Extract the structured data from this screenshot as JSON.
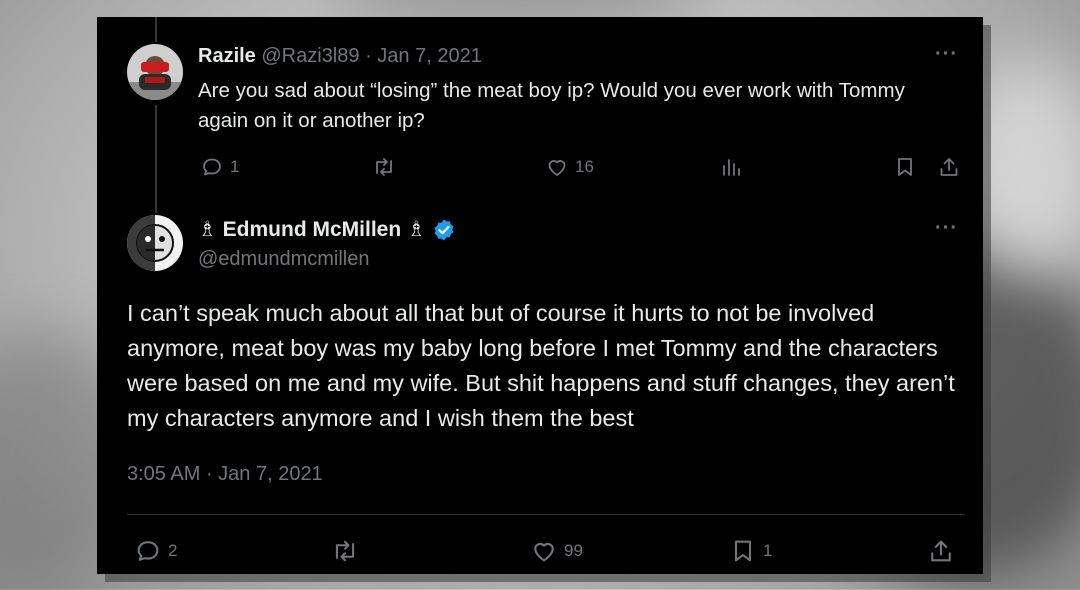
{
  "reply": {
    "name": "Razile",
    "handle": "@Razi3l89",
    "dot": "·",
    "date": "Jan 7, 2021",
    "text": "Are you sad about “losing” the meat boy ip? Would you ever work with Tommy again on it or another ip?",
    "more": "···",
    "icons": [
      "comment-icon",
      "retweet-icon",
      "like-icon",
      "views-icon",
      "bookmark-icon",
      "share-icon"
    ],
    "stats": {
      "replies": "1",
      "likes": "16"
    }
  },
  "main": {
    "name": "♗ Edmund McMillen ♗",
    "handle": "@edmundmcmillen",
    "verified": true,
    "more": "···",
    "text": "I can’t speak much about all that but  of course it hurts to not be involved anymore, meat boy was my baby long before I met Tommy and the characters were based on me and my wife. But shit happens and stuff changes, they aren’t my characters anymore and I wish them the best",
    "time": "3:05 AM · Jan 7, 2021",
    "icons": [
      "comment-icon",
      "retweet-icon",
      "like-icon",
      "bookmark-icon",
      "share-icon"
    ],
    "stats": {
      "replies": "2",
      "likes": "99",
      "bookmarks": "1"
    }
  },
  "colors": {
    "background": "#000000",
    "text": "#e7e9ea",
    "muted": "#71767b",
    "verified": "#1d9bf0"
  }
}
